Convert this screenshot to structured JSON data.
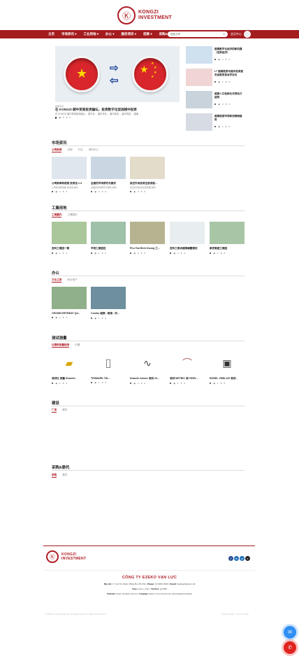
{
  "brand": {
    "name_line1": "KONGZI",
    "name_line2": "INVESTMENT",
    "logo_glyph": "Ⓚ"
  },
  "nav": {
    "items": [
      "主页",
      "市场资讯 ▾",
      "工业用地 ▾",
      "办公 ▾",
      "服务项目 ▾",
      "招商 ▾",
      "采购&委托 ▾"
    ],
    "search_placeholder": "搜索文章",
    "member_label": "会员中心"
  },
  "hero": {
    "tag": "越南新闻",
    "title": "在 KONGZI 越中贸易投资論坛，投资数字化促进越中投资",
    "desc": "在 KONGZI 越中贸易投资論坛 ... 数字化 ... 越中关系 ... 越中投资 ... 越中贸易 ... 越南 ...",
    "meta_views": "5",
    "meta_likes": "0"
  },
  "side_news": [
    {
      "title": "越南数字化经济的新机遇（世界经济）",
      "views": "2",
      "likes": "0"
    },
    {
      "title": "LT 越南政府与越中投资委员会就贸易合作论坛",
      "views": "1",
      "likes": "0"
    },
    {
      "title": "越南人口老龄化与劳动力结构",
      "views": "3",
      "likes": "0"
    },
    {
      "title": "越南旅游市场和消费新趋势",
      "views": "1",
      "likes": "0"
    }
  ],
  "sections": {
    "market": {
      "title": "市场资讯",
      "tabs": [
        "公司新闻",
        "法规",
        "行业",
        "资料中心"
      ]
    },
    "land": {
      "title": "工業用地",
      "tabs": [
        "工業園内",
        "工業园外"
      ]
    },
    "office": {
      "title": "办公",
      "tabs": [
        "文化之旅",
        "商业地产"
      ]
    },
    "tools": {
      "title": "测试测量",
      "tabs": [
        "仪器和测量检测",
        "仪器"
      ]
    },
    "build": {
      "title": "建设",
      "tabs": [
        "厂房",
        "楼宇"
      ]
    },
    "procure": {
      "title": "采购&委托",
      "tabs": [
        "采购",
        "委托"
      ]
    }
  },
  "market_cards": [
    {
      "title": "公司新闻和政策 投资设 2-3",
      "desc": "公司新闻和政策 投资设 越中",
      "views": "4",
      "likes": "0"
    },
    {
      "title": "全面的市场研究与服务",
      "desc": "全面的市场研究与服务 越中",
      "views": "3",
      "likes": "0"
    },
    {
      "title": "接近外商投资注册流程...",
      "desc": "接近外商投资注册流程 越中",
      "views": "6",
      "likes": "0"
    }
  ],
  "land_cards": [
    {
      "title": "吉利工業园一期",
      "views": "2",
      "likes": "0"
    },
    {
      "title": "平阳工業园区",
      "views": "1",
      "likes": "0"
    },
    {
      "title": "Phu Tan Binh Duong 工...",
      "views": "3",
      "likes": "0"
    },
    {
      "title": "吉利三角洲越南總體规划",
      "views": "1",
      "likes": "0"
    },
    {
      "title": "新安集团工業园",
      "views": "2",
      "likes": "0"
    }
  ],
  "office_cards": [
    {
      "title": "CROWN RETREAT QU...",
      "views": "2",
      "likes": "0"
    },
    {
      "title": "Combo 越南 - 岘港 - 河...",
      "views": "1",
      "likes": "0"
    }
  ],
  "tool_cards": [
    {
      "title": "测试仪 测量 Drauchi...",
      "views": "1",
      "likes": "0",
      "glyph": "▰"
    },
    {
      "title": "TESMARK TM-...",
      "views": "1",
      "likes": "0",
      "glyph": "▯"
    },
    {
      "title": "Drauchi Amour 测试 20...",
      "views": "2",
      "likes": "0",
      "glyph": "∿"
    },
    {
      "title": "测试 METBIC 测 VIDEL...",
      "views": "1",
      "likes": "0",
      "glyph": "⌒"
    },
    {
      "title": "BONEL VMM-120 测试...",
      "views": "1",
      "likes": "0",
      "glyph": "▣"
    }
  ],
  "footer": {
    "company": "CÔNG TY EZEKO VẠN LỰC",
    "address_label": "Địa chỉ:",
    "address": "17/1A Tây Ninh, Hồng Hạ, Hà Nội",
    "phone_label": "Phone:",
    "phone": "03 9999 9999",
    "email_label": "Email:",
    "email": "lienhe@gmail.com",
    "line_label": "Line:",
    "line": "peace_class",
    "wechat_label": "Wechat:",
    "wechat": "pq7999",
    "website_label": "Website:",
    "website": "https://kongzi.com.vn/",
    "fanpage_label": "Fanpage:",
    "fanpage": "https://www.facebook.com/kongziinvestment",
    "copyright": "© 2024 Kongzi Investment. All rights reserved. Thiết kế bởi Ezeko.",
    "copyright_right": "Privacy Policy · Terms of Use",
    "social": [
      "f",
      "in",
      "yt",
      "z"
    ]
  },
  "colors": {
    "brand": "#a51c1f",
    "messenger": "#2f8ff2",
    "call": "#e0231e"
  }
}
